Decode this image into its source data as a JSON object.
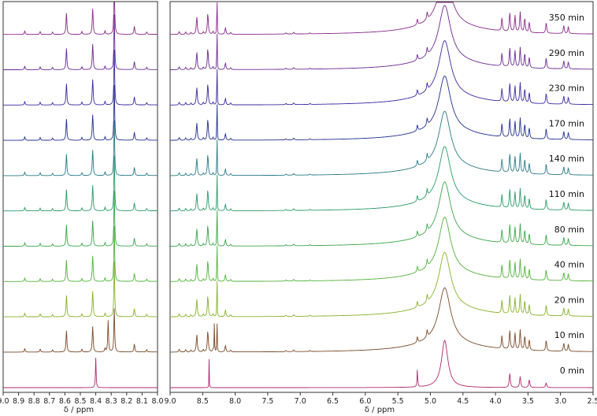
{
  "chart_data": {
    "type": "line",
    "title": "",
    "xlabel": "δ / ppm",
    "ylabel": "",
    "panels": [
      {
        "name": "zoom",
        "xlim": [
          9.0,
          8.0
        ],
        "ticks": [
          "9.0",
          "8.9",
          "8.8",
          "8.7",
          "8.6",
          "8.5",
          "8.4",
          "8.3",
          "8.2",
          "8.1",
          "8.0"
        ],
        "tick_values": [
          9.0,
          8.9,
          8.8,
          8.7,
          8.6,
          8.5,
          8.4,
          8.3,
          8.2,
          8.1,
          8.0
        ]
      },
      {
        "name": "full",
        "xlim": [
          9.0,
          2.5
        ],
        "ticks": [
          "9.0",
          "8.5",
          "8.0",
          "7.5",
          "7.0",
          "6.5",
          "6.0",
          "5.5",
          "5.0",
          "4.5",
          "4.0",
          "3.5",
          "3.0",
          "2.5"
        ],
        "tick_values": [
          9.0,
          8.5,
          8.0,
          7.5,
          7.0,
          6.5,
          6.0,
          5.5,
          5.0,
          4.5,
          4.0,
          3.5,
          3.0,
          2.5
        ]
      }
    ],
    "series": [
      {
        "name": "350 min",
        "color": "#8a2a8a"
      },
      {
        "name": "290 min",
        "color": "#6a2a92"
      },
      {
        "name": "230 min",
        "color": "#3a2aa0"
      },
      {
        "name": "170 min",
        "color": "#22308e"
      },
      {
        "name": "140 min",
        "color": "#2a7a88"
      },
      {
        "name": "110 min",
        "color": "#2a9a6a"
      },
      {
        "name": "80 min",
        "color": "#3aa64a"
      },
      {
        "name": "40 min",
        "color": "#52b23a"
      },
      {
        "name": "20 min",
        "color": "#86b22a"
      },
      {
        "name": "10 min",
        "color": "#7a4a2a"
      },
      {
        "name": "0 min",
        "color": "#b0286e"
      }
    ],
    "peaks_ppm": [
      {
        "ppm": 8.86,
        "height": 0.12
      },
      {
        "ppm": 8.76,
        "height": 0.1
      },
      {
        "ppm": 8.68,
        "height": 0.08
      },
      {
        "ppm": 8.59,
        "height": 0.75
      },
      {
        "ppm": 8.49,
        "height": 0.1
      },
      {
        "ppm": 8.42,
        "height": 0.9
      },
      {
        "ppm": 8.34,
        "height": 0.12
      },
      {
        "ppm": 8.15,
        "height": 0.28
      },
      {
        "ppm": 8.07,
        "height": 0.08
      },
      {
        "ppm": 7.22,
        "height": 0.05
      },
      {
        "ppm": 7.1,
        "height": 0.07
      },
      {
        "ppm": 6.85,
        "height": 0.04
      },
      {
        "ppm": 5.2,
        "height": 0.25
      },
      {
        "ppm": 5.05,
        "height": 0.3
      },
      {
        "ppm": 3.9,
        "height": 0.55
      },
      {
        "ppm": 3.78,
        "height": 0.8
      },
      {
        "ppm": 3.7,
        "height": 0.7
      },
      {
        "ppm": 3.62,
        "height": 0.85
      },
      {
        "ppm": 3.55,
        "height": 0.6
      },
      {
        "ppm": 3.48,
        "height": 0.45
      },
      {
        "ppm": 3.22,
        "height": 0.45
      },
      {
        "ppm": 2.95,
        "height": 0.35
      },
      {
        "ppm": 2.88,
        "height": 0.3
      }
    ],
    "reference_peak_ppm": 8.4,
    "water_peak_ppm": 4.78,
    "product_peak_ppm": 8.28,
    "grid": false,
    "legend": "inline-right"
  }
}
